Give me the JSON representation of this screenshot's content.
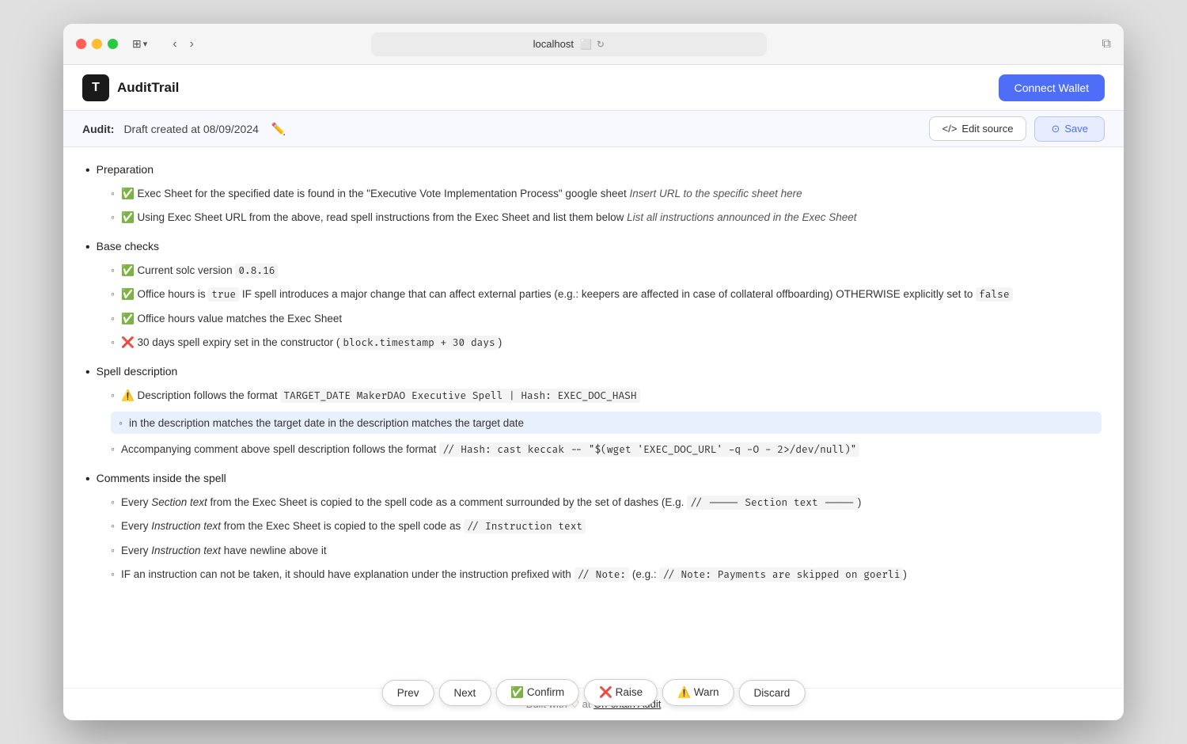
{
  "window": {
    "title": "localhost",
    "url": "localhost"
  },
  "header": {
    "logo_icon": "T",
    "app_name": "AuditTrail",
    "connect_wallet": "Connect Wallet"
  },
  "audit_bar": {
    "label": "Audit:",
    "draft_text": "Draft created at 08/09/2024",
    "edit_source": "Edit source",
    "save": "Save"
  },
  "content": {
    "sections": [
      {
        "title": "Preparation",
        "items": [
          {
            "icon": "✅",
            "text": "Exec Sheet for the specified date is found in the \"Executive Vote Implementation Process\" google sheet",
            "italic": "Insert URL to the specific sheet here",
            "has_italic": true
          },
          {
            "icon": "✅",
            "text": "Using Exec Sheet URL from the above, read spell instructions from the Exec Sheet and list them below",
            "italic": "List all instructions announced in the Exec Sheet",
            "has_italic": true
          }
        ]
      },
      {
        "title": "Base checks",
        "items": [
          {
            "icon": "✅",
            "text": "Current solc version ",
            "code": "0.8.16",
            "has_code": true
          },
          {
            "icon": "✅",
            "text_parts": [
              "Office hours is ",
              "true",
              " IF spell introduces a major change that can affect external parties (e.g.: keepers are affected in case of collateral offboarding) OTHERWISE explicitly set to ",
              "false"
            ],
            "has_multicode": true
          },
          {
            "icon": "✅",
            "text": "Office hours value matches the Exec Sheet",
            "has_italic": false
          },
          {
            "icon": "❌",
            "text": "30 days spell expiry set in the constructor (",
            "code": "block.timestamp + 30 days",
            "text_after": ")",
            "has_code": true
          }
        ]
      },
      {
        "title": "Spell description",
        "items": [
          {
            "icon": "⚠️",
            "text": "Description follows the format ",
            "code": "TARGET_DATE MakerDAO Executive Spell | Hash: EXEC_DOC_HASH",
            "has_code": true
          }
        ],
        "highlighted_item": "in the description matches the target date in the description matches the target date",
        "extra_items": [
          {
            "icon": "",
            "text": "Accompanying comment above spell description follows the format ",
            "code": "// Hash: cast keccak -- \"$(wget 'EXEC_DOC_URL' -q -O - 2>/dev/null)\"",
            "has_code": true
          }
        ]
      },
      {
        "title": "Comments inside the spell",
        "items": [
          {
            "icon": "",
            "text_before": "Every ",
            "italic_part": "Section text",
            "text_after": " from the Exec Sheet is copied to the spell code as a comment surrounded by the set of dashes (E.g. ",
            "code": "// ----- Section text -----",
            "text_end": ")",
            "has_mixed": true
          },
          {
            "icon": "",
            "text_before": "Every ",
            "italic_part": "Instruction text",
            "text_after": " from the Exec Sheet is copied to the spell code as ",
            "code": "// Instruction text",
            "has_mixed": true
          },
          {
            "icon": "",
            "text_before": "Every ",
            "italic_part": "Instruction text",
            "text_after": " have newline above it",
            "has_mixed": true
          },
          {
            "icon": "",
            "text": "IF an instruction can not be taken, it should have explanation under the instruction prefixed with ",
            "code": "// Note:",
            "text_after": " (e.g.: ",
            "code2": "// Note: Payments are skipped on goerli",
            "text_end": ")",
            "has_multicode2": true
          }
        ]
      }
    ]
  },
  "toolbar": {
    "prev": "Prev",
    "next": "Next",
    "confirm": "✅ Confirm",
    "raise": "❌ Raise",
    "warn": "⚠️ Warn",
    "discard": "Discard"
  },
  "footer": {
    "text_before": "Built with",
    "heart": "♡",
    "text_middle": "at",
    "link_text": "On-chain Audit",
    "link_url": "#"
  }
}
